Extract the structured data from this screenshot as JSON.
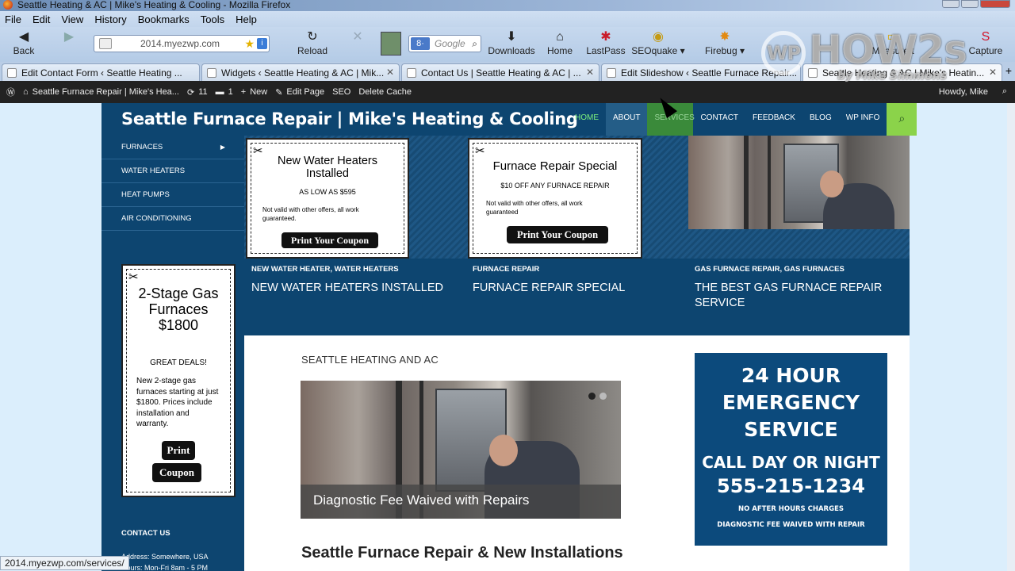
{
  "window": {
    "title": "Seattle Heating & AC | Mike's Heating & Cooling - Mozilla Firefox"
  },
  "menubar": [
    "File",
    "Edit",
    "View",
    "History",
    "Bookmarks",
    "Tools",
    "Help"
  ],
  "toolbar": {
    "back": "Back",
    "reload": "Reload",
    "url": "2014.myezwp.com",
    "search_placeholder": "Google",
    "downloads": "Downloads",
    "home": "Home",
    "lastpass": "LastPass",
    "seoquake": "SEOquake",
    "firebug": "Firebug",
    "measureit": "MeasureIt",
    "capture": "Capture"
  },
  "tabs": [
    "Edit Contact Form ‹ Seattle Heating ...",
    "Widgets ‹ Seattle Heating & AC | Mik...",
    "Contact Us | Seattle Heating & AC | ...",
    "Edit Slideshow ‹ Seattle Furnace Repair...",
    "Seattle Heating & AC | Mike's Heatin..."
  ],
  "wpbar": {
    "site": "Seattle Furnace Repair | Mike's Hea...",
    "updates": "11",
    "comments": "1",
    "new": "New",
    "edit_page": "Edit Page",
    "seo": "SEO",
    "delete_cache": "Delete Cache",
    "howdy": "Howdy, Mike"
  },
  "site": {
    "title": "Seattle Furnace Repair | Mike's Heating & Cooling",
    "nav": [
      "HOME",
      "ABOUT",
      "SERVICES",
      "CONTACT",
      "FEEDBACK",
      "BLOG",
      "WP INFO"
    ],
    "sidebar_menu": [
      "FURNACES",
      "WATER HEATERS",
      "HEAT PUMPS",
      "AIR CONDITIONING"
    ],
    "coupon1": {
      "title": "New Water Heaters Installed",
      "price": "AS LOW AS $595",
      "fine": "Not valid with other offers, all work guaranteed.",
      "button": "Print Your Coupon"
    },
    "coupon2": {
      "title": "Furnace Repair Special",
      "price": "$10 OFF ANY FURNACE REPAIR",
      "fine": "Not valid with other offers, all work guaranteed",
      "button": "Print Your Coupon"
    },
    "coupon3": {
      "title": "2-Stage Gas Furnaces $1800",
      "deal": "GREAT DEALS!",
      "body": "New 2-stage gas furnaces starting at just $1800. Prices include installation and warranty.",
      "button1": "Print",
      "button2": "Coupon"
    },
    "posts": [
      {
        "cats": "NEW WATER HEATER, WATER HEATERS",
        "title": "NEW WATER HEATERS INSTALLED"
      },
      {
        "cats": "FURNACE REPAIR",
        "title": "FURNACE REPAIR SPECIAL"
      },
      {
        "cats": "GAS FURNACE REPAIR, GAS FURNACES",
        "title": "THE BEST GAS FURNACE REPAIR SERVICE"
      }
    ],
    "section_label": "SEATTLE HEATING AND AC",
    "slide_caption": "Diagnostic Fee Waived with Repairs",
    "h2": "Seattle Furnace Repair & New Installations",
    "emergency": {
      "l1": "24 HOUR",
      "l2": "EMERGENCY",
      "l3": "SERVICE",
      "l4": "CALL DAY OR NIGHT",
      "phone": "555-215-1234",
      "l5": "NO AFTER HOURS CHARGES",
      "l6": "DIAGNOSTIC FEE WAIVED WITH REPAIR"
    },
    "contact_us": "CONTACT US",
    "address": "Address: Somewhere, USA",
    "hours": "Hours: Mon-Fri 8am - 5 PM"
  },
  "statusbar": "2014.myezwp.com/services/",
  "watermark": {
    "brand": "HOW2s",
    "logo": "WP",
    "by": "by Mike Simmons"
  }
}
